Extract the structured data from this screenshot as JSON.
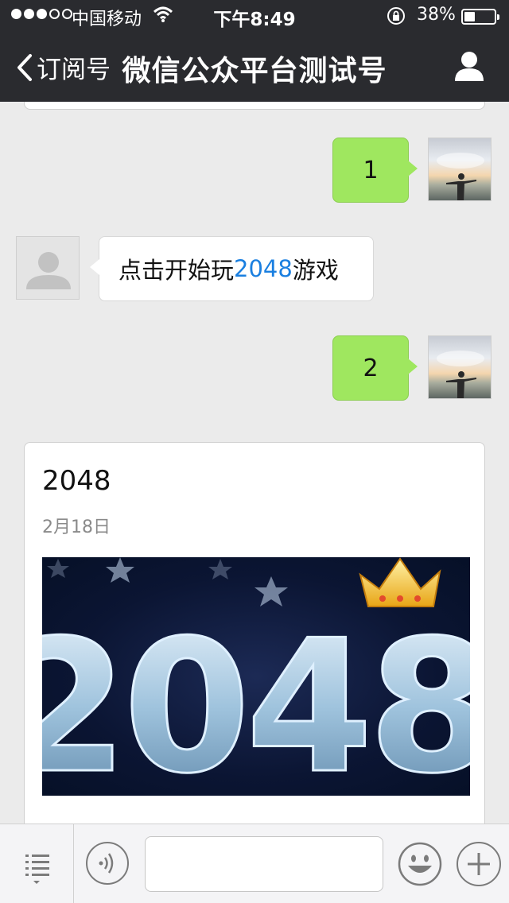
{
  "status_bar": {
    "carrier": "中国移动",
    "time": "下午8:49",
    "battery_percent": "38%",
    "battery_level": 0.38,
    "signal_bars_filled": 3,
    "signal_bars_total": 5
  },
  "nav": {
    "back_label": "订阅号",
    "title": "微信公众平台测试号",
    "icons": {
      "back": "chevron-left-icon",
      "profile": "profile-icon"
    }
  },
  "messages": [
    {
      "type": "sent",
      "text": "1"
    },
    {
      "type": "received",
      "text_prefix": "点击开始玩",
      "link_text": "2048",
      "text_suffix": "游戏"
    },
    {
      "type": "sent",
      "text": "2"
    }
  ],
  "article": {
    "title": "2048",
    "date": "2月18日",
    "cover_text": "2048"
  },
  "input_bar": {
    "icons": [
      "menu-list-icon",
      "voice-icon",
      "emoji-icon",
      "plus-icon"
    ],
    "input_value": ""
  },
  "colors": {
    "nav_background": "#2a2b2f",
    "chat_background": "#ebebeb",
    "sent_bubble": "#9fe75f",
    "link": "#1a7fe0"
  }
}
